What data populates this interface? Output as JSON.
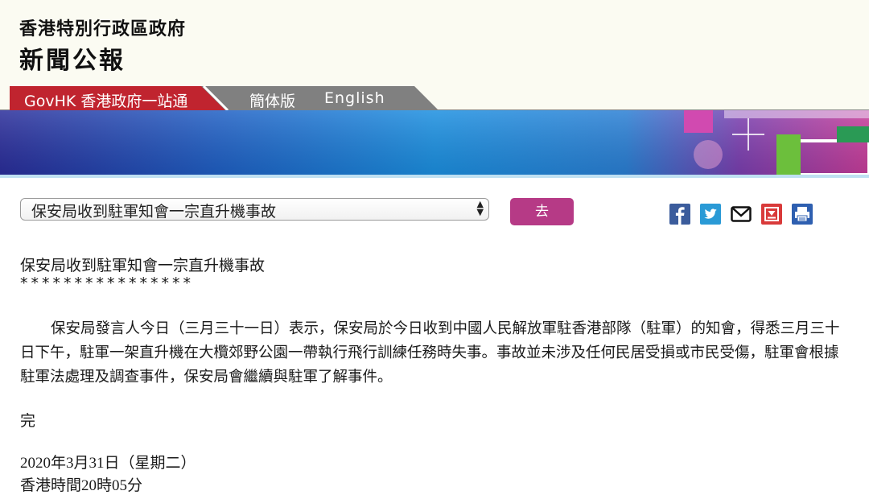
{
  "header": {
    "government_name": "香港特別行政區政府",
    "section_title": "新聞公報"
  },
  "nav": {
    "govhk": "GovHK 香港政府一站通",
    "simplified": "簡体版",
    "english": "English"
  },
  "toolbar": {
    "selected_article": "保安局收到駐軍知會一宗直升機事故",
    "go_label": "去"
  },
  "share_icons": [
    "facebook-icon",
    "twitter-icon",
    "email-icon",
    "bookmark-icon",
    "print-icon"
  ],
  "article": {
    "headline": "保安局收到駐軍知會一宗直升機事故",
    "separator": "****************",
    "body": "保安局發言人今日（三月三十一日）表示，保安局於今日收到中國人民解放軍駐香港部隊（駐軍）的知會，得悉三月三十日下午，駐軍一架直升機在大欖郊野公園一帶執行飛行訓練任務時失事。事故並未涉及任何民居受損或市民受傷，駐軍會根據駐軍法處理及調查事件，保安局會繼續與駐軍了解事件。",
    "end_mark": "完",
    "date": "2020年3月31日（星期二）",
    "time": "香港時間20時05分"
  },
  "colors": {
    "govhk_tab": "#c0242f",
    "grey_tab": "#7f7f7f",
    "go_button": "#b63a86",
    "banner_blue": "#1b7fd6",
    "banner_purple": "#6a2fa3"
  }
}
